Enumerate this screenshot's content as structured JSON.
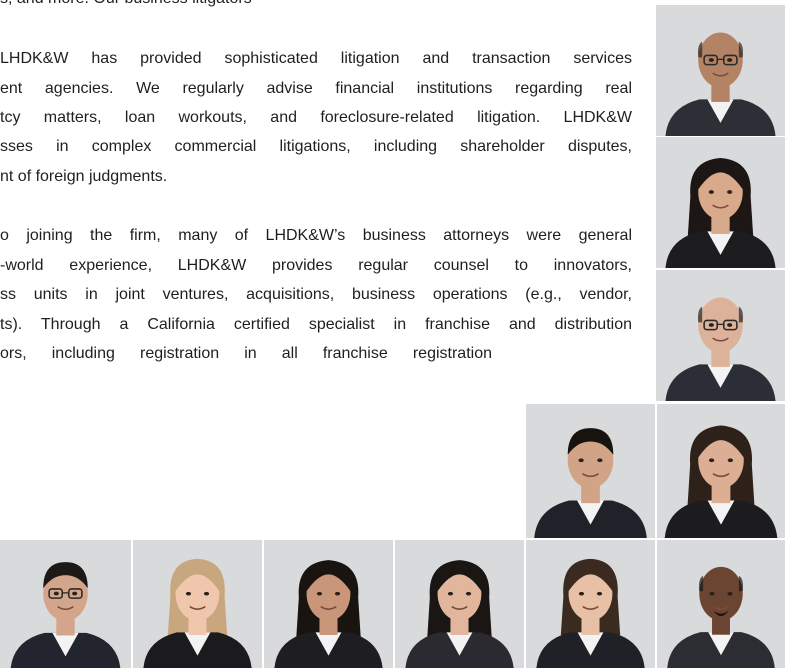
{
  "colors": {
    "text": "#1f1f1f",
    "photo_background": "#d9dadc",
    "suit_dark": "#23262d",
    "shirt_white": "#f3f3f3"
  },
  "paragraphs": [
    {
      "lines": [
        "s, and more. Our business litigators"
      ]
    },
    {
      "lines": [
        "LHDK&W has provided sophisticated litigation and transaction services",
        "ent agencies.  We regularly advise financial institutions regarding real",
        "tcy matters, loan workouts, and foreclosure-related litigation. LHDK&W",
        "sses in complex commercial litigations, including shareholder disputes,",
        "nt of foreign judgments."
      ]
    },
    {
      "lines": [
        "o joining the firm, many of LHDK&W’s business attorneys were general",
        "-world experience, LHDK&W provides regular counsel to innovators,",
        "ss units in joint ventures, acquisitions, business operations (e.g., vendor,",
        "ts).  Through a California certified specialist in franchise and distribution",
        "ors, including registration in all franchise registration"
      ]
    }
  ],
  "attorney_photos": [
    {
      "name": "attorney-photo-1",
      "skin": "#b48366",
      "hair": "#2a2320",
      "style": "bald-glasses",
      "suit": "#2c2f35"
    },
    {
      "name": "attorney-photo-2",
      "skin": "#d9a98c",
      "hair": "#1c1714",
      "style": "long-dark",
      "suit": "#1d1d20"
    },
    {
      "name": "attorney-photo-3",
      "skin": "#dcb39a",
      "hair": "#2a2421",
      "style": "bald-glasses",
      "suit": "#2b2e36"
    },
    {
      "name": "attorney-photo-4",
      "skin": "#d2a487",
      "hair": "#17130f",
      "style": "short-dark",
      "suit": "#1f2228"
    },
    {
      "name": "attorney-photo-5",
      "skin": "#dcae93",
      "hair": "#2e211a",
      "style": "long-dark",
      "suit": "#1c1c1f"
    },
    {
      "name": "attorney-photo-6",
      "skin": "#d3a58a",
      "hair": "#1e1916",
      "style": "short-glasses",
      "suit": "#22252d"
    },
    {
      "name": "attorney-photo-7",
      "skin": "#f0c7ad",
      "hair": "#c8a77e",
      "style": "blonde-bob",
      "suit": "#1b1b1e"
    },
    {
      "name": "attorney-photo-8",
      "skin": "#c99679",
      "hair": "#1a1411",
      "style": "long-dark",
      "suit": "#1e1e22"
    },
    {
      "name": "attorney-photo-9",
      "skin": "#e1b69d",
      "hair": "#1a1613",
      "style": "long-dark",
      "suit": "#2a2a30"
    },
    {
      "name": "attorney-photo-10",
      "skin": "#e7c0a6",
      "hair": "#3b2a1f",
      "style": "short-bob",
      "suit": "#1f2126"
    },
    {
      "name": "attorney-photo-11",
      "skin": "#6b4532",
      "hair": "#1a1412",
      "style": "bald-goatee",
      "suit": "#2b2d33"
    }
  ]
}
